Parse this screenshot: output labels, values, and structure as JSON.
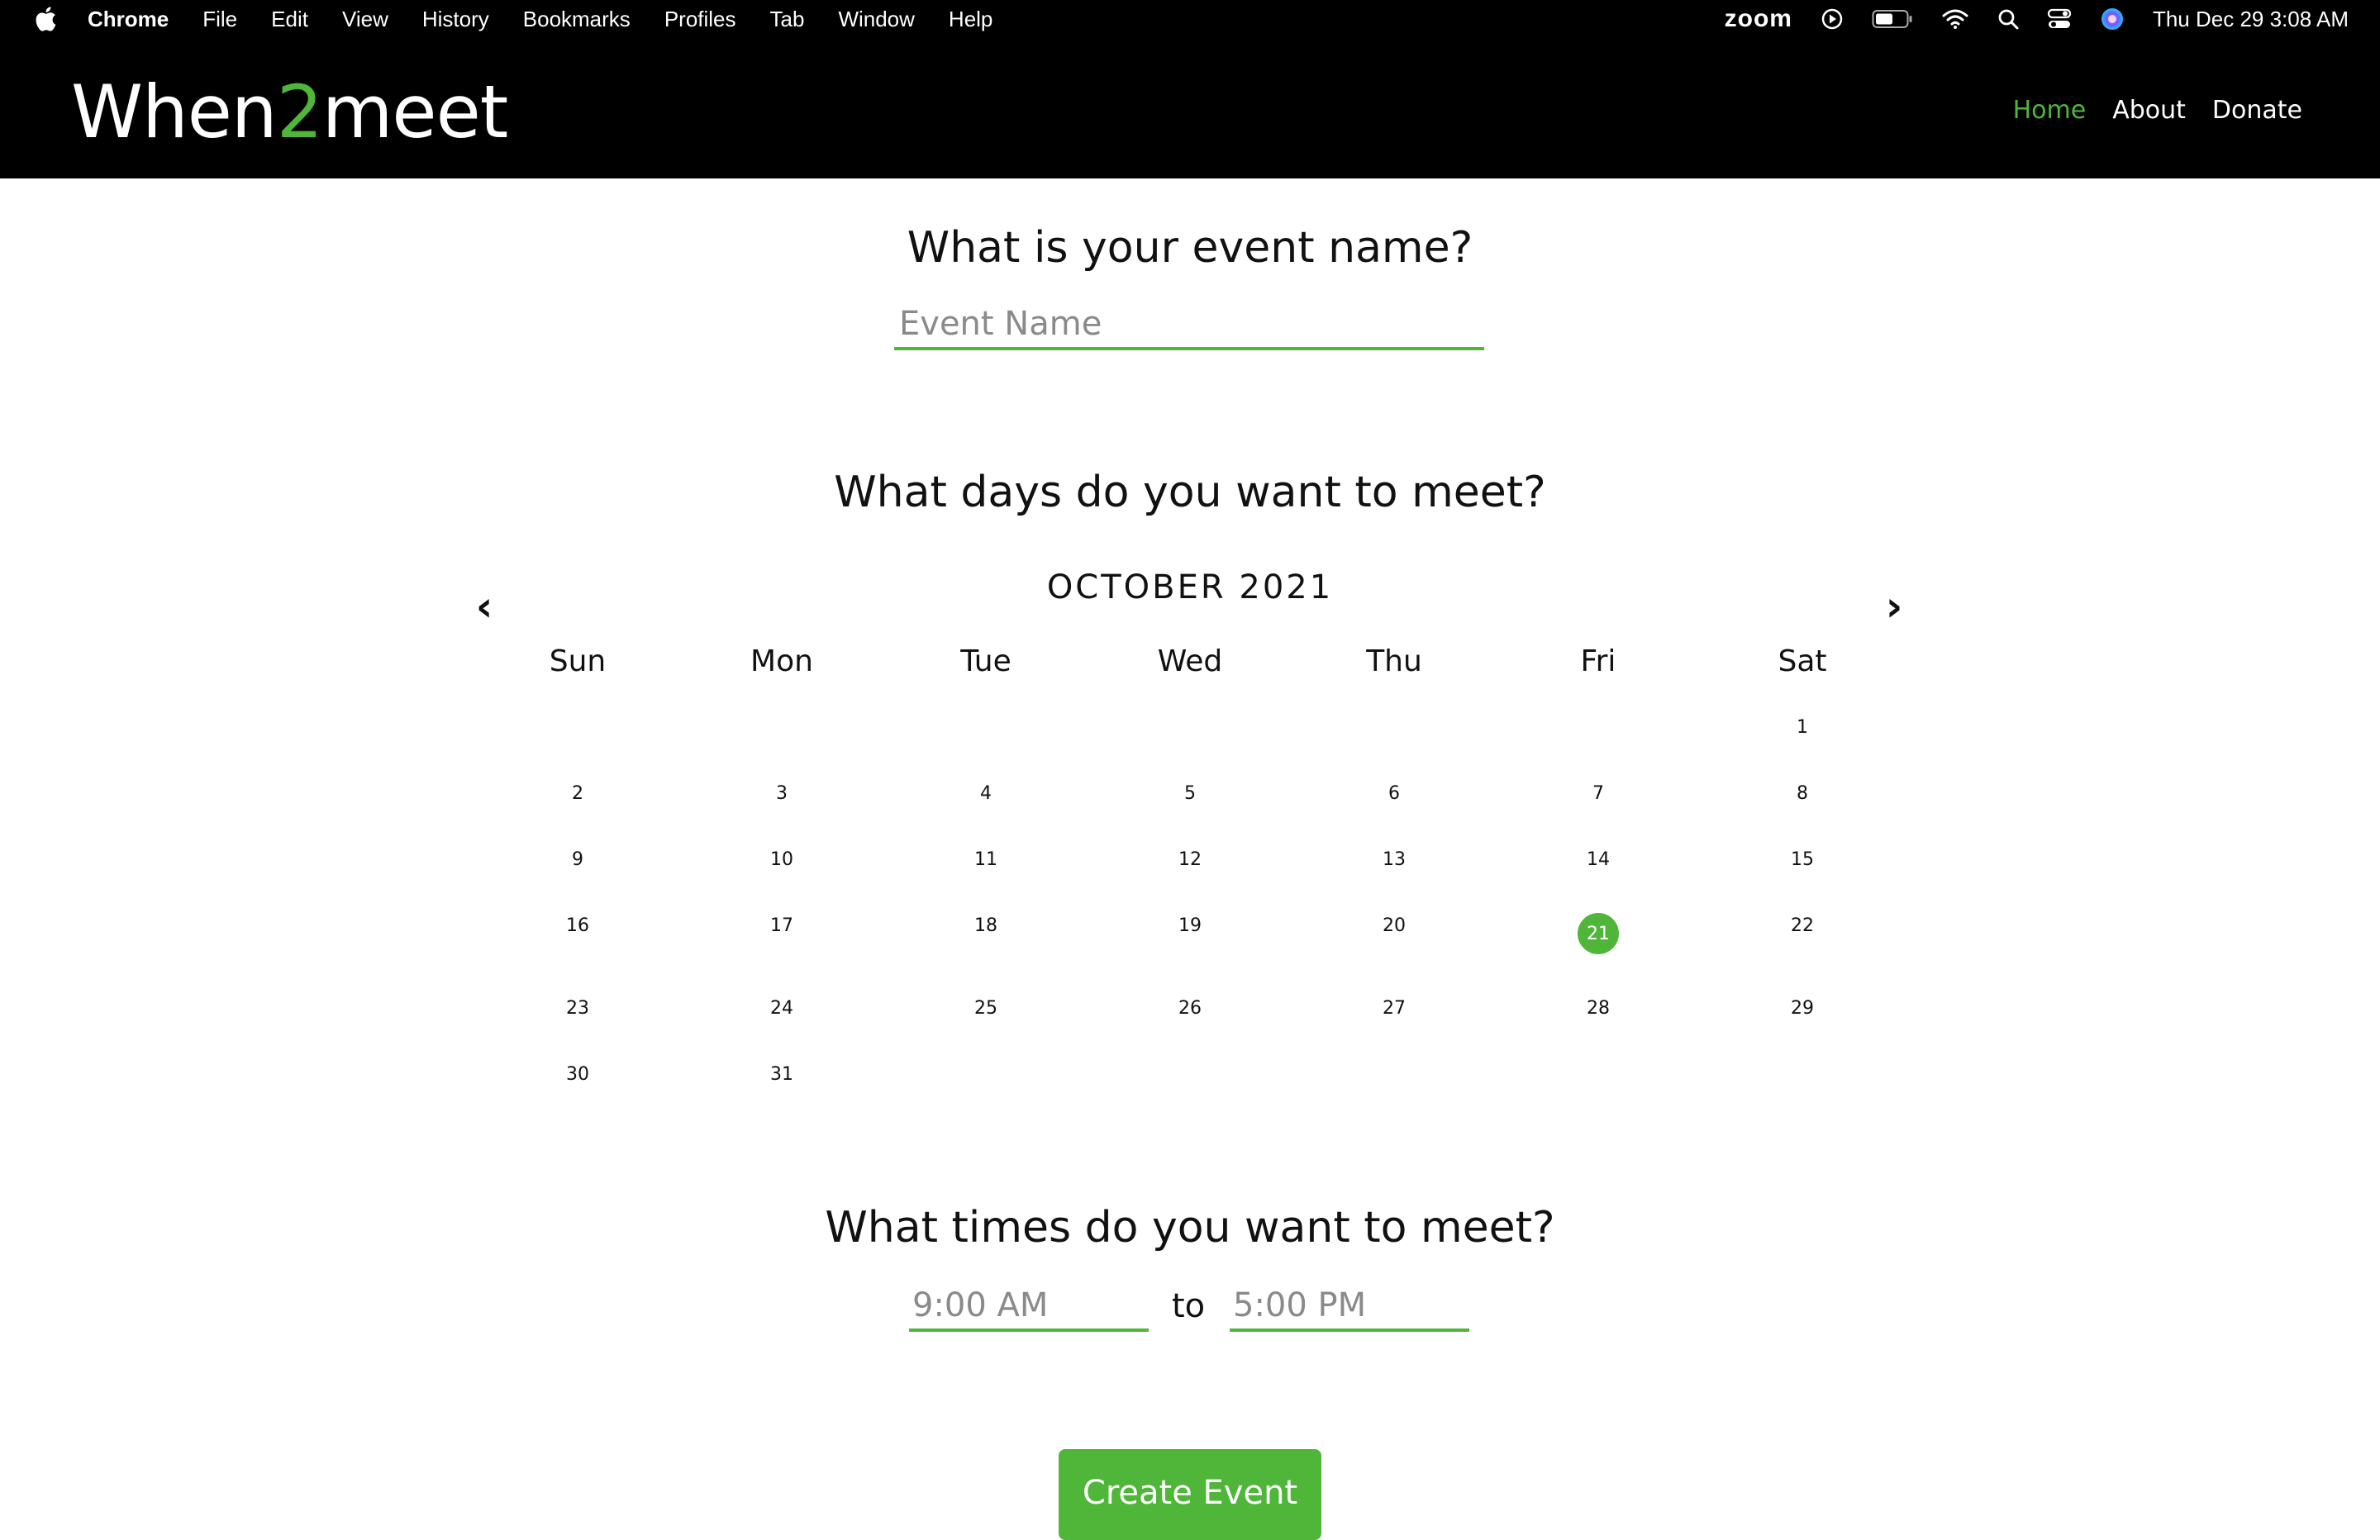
{
  "menubar": {
    "apple_icon": "apple-logo-icon",
    "items": [
      "Chrome",
      "File",
      "Edit",
      "View",
      "History",
      "Bookmarks",
      "Profiles",
      "Tab",
      "Window",
      "Help"
    ],
    "status": {
      "zoom": "zoom",
      "icons": [
        "play-circle-icon",
        "battery-icon",
        "wifi-icon",
        "search-icon",
        "control-center-icon",
        "siri-icon"
      ],
      "clock": "Thu Dec 29  3:08 AM"
    }
  },
  "header": {
    "logo_part1": "When",
    "logo_part2": "2",
    "logo_part3": "meet",
    "nav": [
      "Home",
      "About",
      "Donate"
    ],
    "active_nav": "Home",
    "accent_color": "#4fb63a"
  },
  "event": {
    "heading": "What is your event name?",
    "placeholder": "Event Name",
    "value": ""
  },
  "calendar": {
    "heading": "What days do you want to meet?",
    "month_label": "OCTOBER 2021",
    "prev_icon": "‹",
    "next_icon": "›",
    "weekdays": [
      "Sun",
      "Mon",
      "Tue",
      "Wed",
      "Thu",
      "Fri",
      "Sat"
    ],
    "weeks": [
      [
        "",
        "",
        "",
        "",
        "",
        "",
        "1"
      ],
      [
        "2",
        "3",
        "4",
        "5",
        "6",
        "7",
        "8"
      ],
      [
        "9",
        "10",
        "11",
        "12",
        "13",
        "14",
        "15"
      ],
      [
        "16",
        "17",
        "18",
        "19",
        "20",
        "21",
        "22"
      ],
      [
        "23",
        "24",
        "25",
        "26",
        "27",
        "28",
        "29"
      ],
      [
        "30",
        "31",
        "",
        "",
        "",
        "",
        ""
      ]
    ],
    "selected_days": [
      "21"
    ]
  },
  "times": {
    "heading": "What times do you want to meet?",
    "start_placeholder": "9:00 AM",
    "separator": "to",
    "end_placeholder": "5:00 PM"
  },
  "create_button": "Create Event"
}
